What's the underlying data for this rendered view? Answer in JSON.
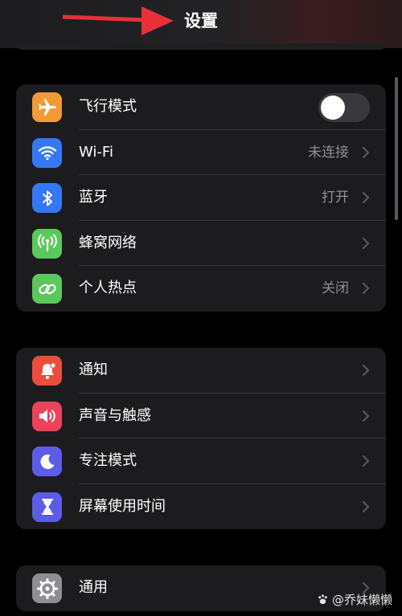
{
  "header": {
    "title": "设置"
  },
  "groups": [
    {
      "rows": [
        {
          "label": "飞行模式",
          "icon": "airplane-icon",
          "icon_color": "#f19a37",
          "toggle": true,
          "toggle_on": false
        },
        {
          "label": "Wi-Fi",
          "icon": "wifi-icon",
          "icon_color": "#3478f6",
          "value": "未连接"
        },
        {
          "label": "蓝牙",
          "icon": "bluetooth-icon",
          "icon_color": "#3478f6",
          "value": "打开"
        },
        {
          "label": "蜂窝网络",
          "icon": "antenna-icon",
          "icon_color": "#5ac85a",
          "value": ""
        },
        {
          "label": "个人热点",
          "icon": "hotspot-icon",
          "icon_color": "#5ac85a",
          "value": "关闭"
        }
      ]
    },
    {
      "rows": [
        {
          "label": "通知",
          "icon": "bell-icon",
          "icon_color": "#eb4d3d"
        },
        {
          "label": "声音与触感",
          "icon": "speaker-icon",
          "icon_color": "#eb445a"
        },
        {
          "label": "专注模式",
          "icon": "moon-icon",
          "icon_color": "#5e5ce6"
        },
        {
          "label": "屏幕使用时间",
          "icon": "hourglass-icon",
          "icon_color": "#5e5ce6"
        }
      ]
    },
    {
      "rows": [
        {
          "label": "通用",
          "icon": "gear-icon",
          "icon_color": "#8e8e93"
        }
      ]
    }
  ],
  "watermark": {
    "text": "@乔妹懒懒",
    "icon": "paw-icon"
  },
  "colors": {
    "background": "#000000",
    "group_background": "#1c1c1e",
    "secondary_text": "#8e8e93",
    "annotation_arrow": "#e8303a"
  }
}
